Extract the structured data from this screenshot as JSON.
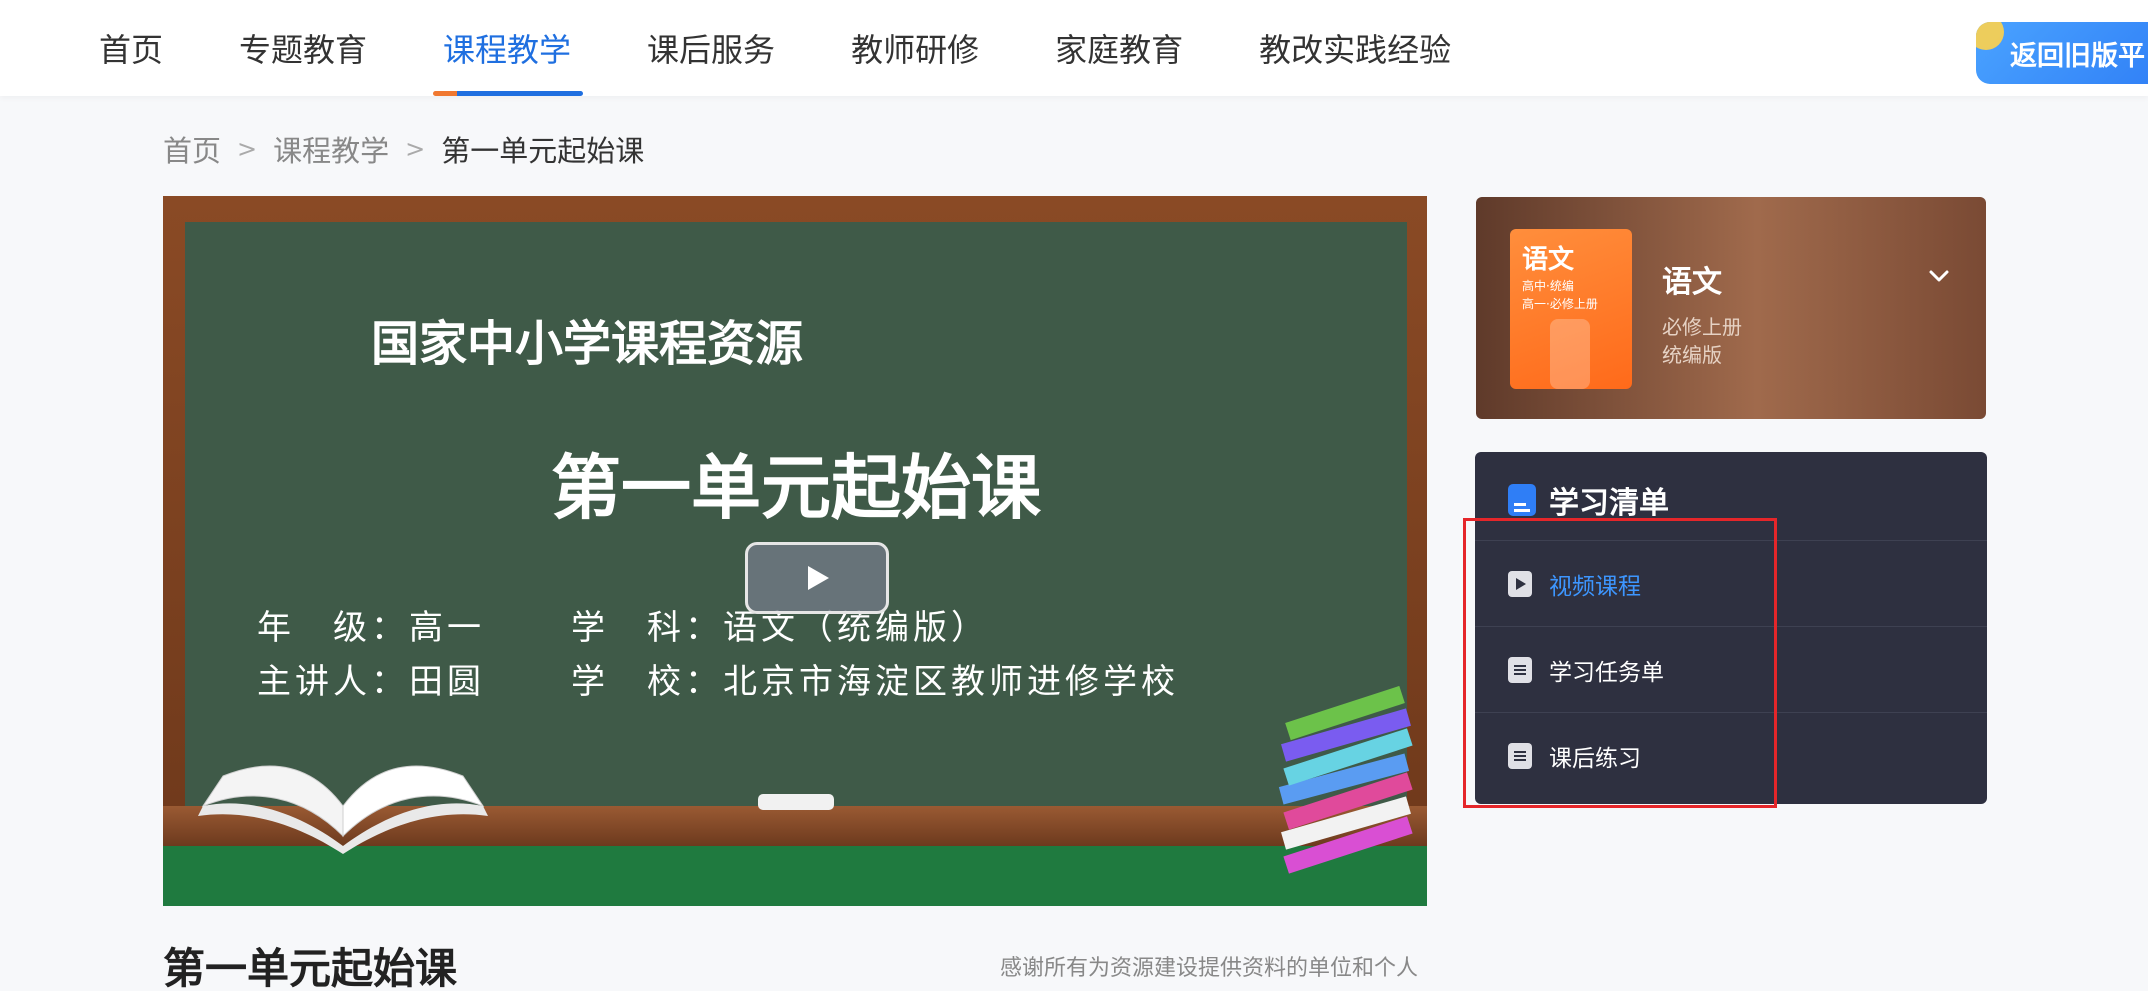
{
  "nav": {
    "items": [
      {
        "label": "首页"
      },
      {
        "label": "专题教育"
      },
      {
        "label": "课程教学"
      },
      {
        "label": "课后服务"
      },
      {
        "label": "教师研修"
      },
      {
        "label": "家庭教育"
      },
      {
        "label": "教改实践经验"
      }
    ],
    "active_index": 2,
    "old_version_label": "返回旧版平"
  },
  "breadcrumb": {
    "home": "首页",
    "section": "课程教学",
    "current": "第一单元起始课",
    "separator": ">"
  },
  "video": {
    "org": "国家中小学课程资源",
    "title": "第一单元起始课",
    "grade_line": "年　级：高一",
    "subject_line": "学　科：语文（统编版）",
    "teacher_line": "主讲人：田圆",
    "school_line": "学　校：北京市海淀区教师进修学校"
  },
  "lesson": {
    "title": "第一单元起始课",
    "thanks": "感谢所有为资源建设提供资料的单位和个人"
  },
  "textbook": {
    "cover_title": "语文",
    "cover_sub1": "高中·统编",
    "cover_sub2": "高一·必修上册",
    "name": "语文",
    "volume": "必修上册",
    "edition": "统编版"
  },
  "study_list": {
    "title": "学习清单",
    "items": [
      {
        "label": "视频课程",
        "icon": "video-icon",
        "active": true
      },
      {
        "label": "学习任务单",
        "icon": "document-icon",
        "active": false
      },
      {
        "label": "课后练习",
        "icon": "document-icon",
        "active": false
      }
    ]
  },
  "colors": {
    "accent": "#1f6fe0",
    "active_link": "#3d96ff",
    "highlight": "#e5262a",
    "panel": "#2e3040"
  }
}
